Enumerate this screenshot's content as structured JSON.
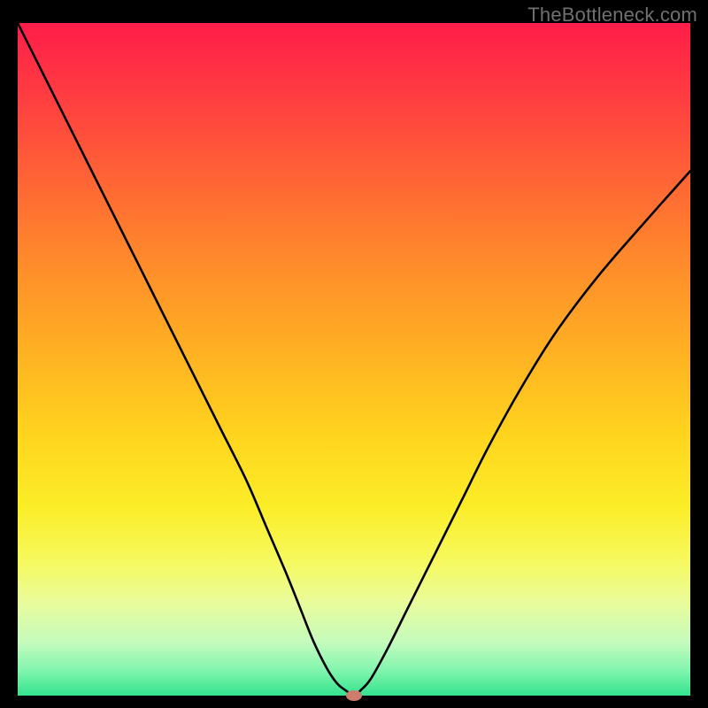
{
  "watermark": "TheBottleneck.com",
  "chart_data": {
    "type": "line",
    "title": "",
    "xlabel": "",
    "ylabel": "",
    "xlim": [
      0,
      100
    ],
    "ylim": [
      0,
      100
    ],
    "background_gradient": {
      "top": "#ff1d49",
      "middle": "#ffd61e",
      "bottom": "#34e38f"
    },
    "series": [
      {
        "name": "curve",
        "color": "#000000",
        "x": [
          0,
          3,
          6,
          10,
          14,
          18,
          22,
          26,
          30,
          34,
          37,
          40,
          42,
          44,
          46,
          47.5,
          49,
          50,
          51,
          52.5,
          55,
          58,
          62,
          66,
          70,
          75,
          80,
          86,
          92,
          100
        ],
        "y": [
          100,
          94,
          88,
          80,
          72,
          64,
          56,
          48,
          40,
          32,
          25,
          18,
          13,
          8,
          4,
          1.8,
          0.6,
          0,
          0.8,
          2.5,
          7,
          13,
          21,
          29,
          37,
          46,
          54,
          62,
          69,
          78
        ]
      }
    ],
    "marker": {
      "name": "optimal-point",
      "x": 50,
      "y": 0,
      "color": "#cd7c6e"
    }
  }
}
